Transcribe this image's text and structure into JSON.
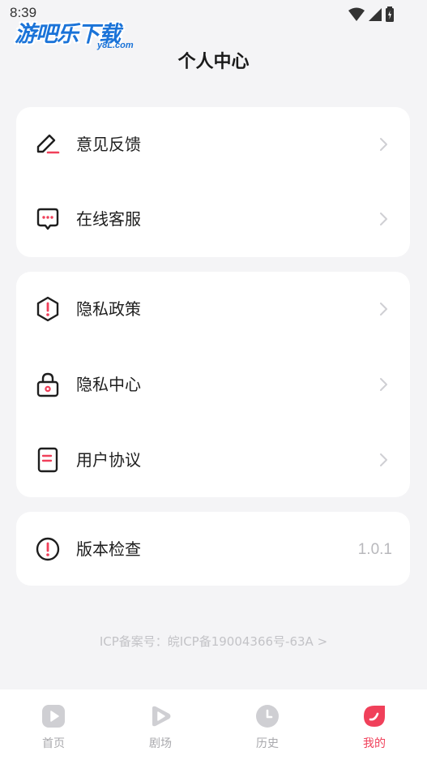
{
  "status_bar": {
    "time": "8:39"
  },
  "watermark": {
    "main": "游吧乐下载",
    "sub": "y8L.com"
  },
  "header": {
    "title": "个人中心"
  },
  "groups": [
    {
      "items": [
        {
          "label": "意见反馈",
          "icon": "pencil-edit-icon"
        },
        {
          "label": "在线客服",
          "icon": "chat-bubble-icon"
        }
      ]
    },
    {
      "items": [
        {
          "label": "隐私政策",
          "icon": "shield-alert-icon"
        },
        {
          "label": "隐私中心",
          "icon": "lock-icon"
        },
        {
          "label": "用户协议",
          "icon": "document-icon"
        }
      ]
    },
    {
      "items": [
        {
          "label": "版本检查",
          "icon": "alert-circle-icon",
          "value": "1.0.1"
        }
      ]
    }
  ],
  "footer": {
    "icp": "ICP备案号：皖ICP备19004366号-63A >"
  },
  "tabbar": {
    "tabs": [
      {
        "label": "首页",
        "icon": "home-play-icon",
        "active": false
      },
      {
        "label": "剧场",
        "icon": "theater-play-icon",
        "active": false
      },
      {
        "label": "历史",
        "icon": "clock-icon",
        "active": false
      },
      {
        "label": "我的",
        "icon": "profile-icon",
        "active": true
      }
    ]
  },
  "colors": {
    "accent": "#f0405a",
    "inactive": "#a9a9ad",
    "background": "#f4f4f6"
  }
}
